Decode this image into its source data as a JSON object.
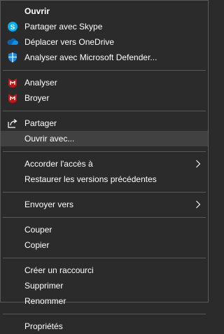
{
  "menu": {
    "items": [
      {
        "label": "Ouvrir"
      },
      {
        "label": "Partager avec Skype",
        "icon": "skype-icon"
      },
      {
        "label": "Déplacer vers OneDrive",
        "icon": "onedrive-icon"
      },
      {
        "label": "Analyser avec Microsoft Defender...",
        "icon": "defender-shield-icon"
      },
      {
        "label": "Analyser",
        "icon": "mcafee-icon"
      },
      {
        "label": "Broyer",
        "icon": "mcafee-icon"
      },
      {
        "label": "Partager",
        "icon": "share-icon"
      },
      {
        "label": "Ouvrir avec..."
      },
      {
        "label": "Accorder l'accès à"
      },
      {
        "label": "Restaurer les versions précédentes"
      },
      {
        "label": "Envoyer vers"
      },
      {
        "label": "Couper"
      },
      {
        "label": "Copier"
      },
      {
        "label": "Créer un raccourci"
      },
      {
        "label": "Supprimer"
      },
      {
        "label": "Renommer"
      },
      {
        "label": "Propriétés"
      }
    ]
  },
  "colors": {
    "background": "#2b2b2b",
    "hover": "#414141",
    "separator": "#5a5a5a",
    "text": "#ffffff",
    "skype": "#00aff0",
    "onedrive": "#0364b8",
    "defender": "#1e88e5",
    "mcafee": "#c01818"
  }
}
